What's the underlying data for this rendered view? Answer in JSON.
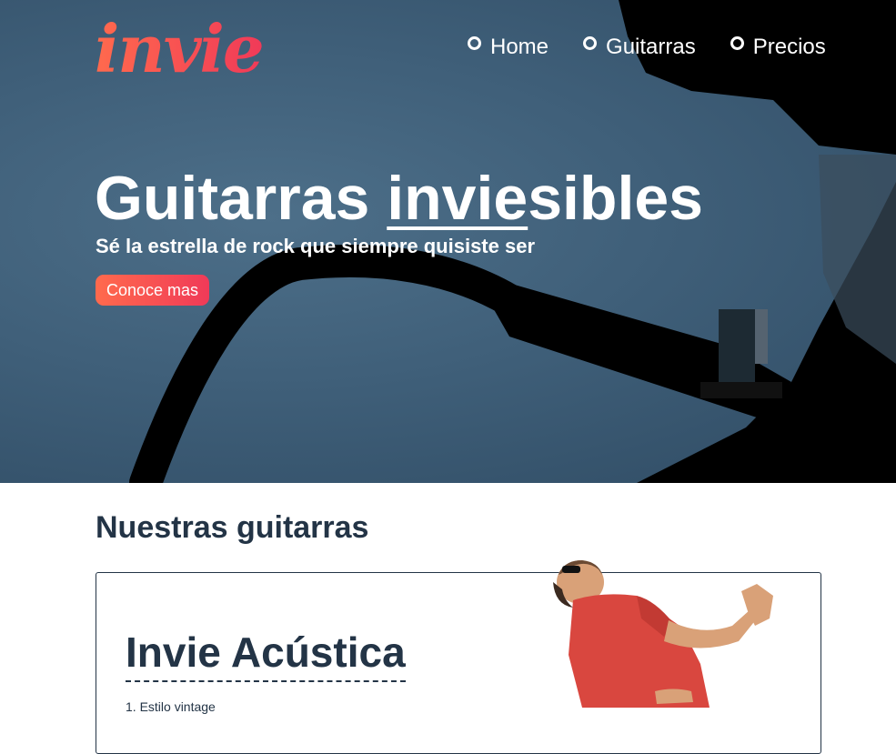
{
  "brand": {
    "logo_text": "invie",
    "accent_start": "#ff6a4d",
    "accent_end": "#f03a58"
  },
  "nav": {
    "items": [
      "Home",
      "Guitarras",
      "Precios"
    ]
  },
  "hero": {
    "title_before": "Guitarras ",
    "title_underlined": "invie",
    "title_after": "sibles",
    "subtitle": "Sé la estrella de rock que siempre quisiste ser",
    "cta_label": "Conoce mas"
  },
  "section": {
    "title": "Nuestras guitarras",
    "card_title": "Invie Acústica",
    "card_list_first": "1. Estilo vintage"
  },
  "colors": {
    "text_dark": "#233446",
    "hero_bg": "#3f5f79"
  }
}
